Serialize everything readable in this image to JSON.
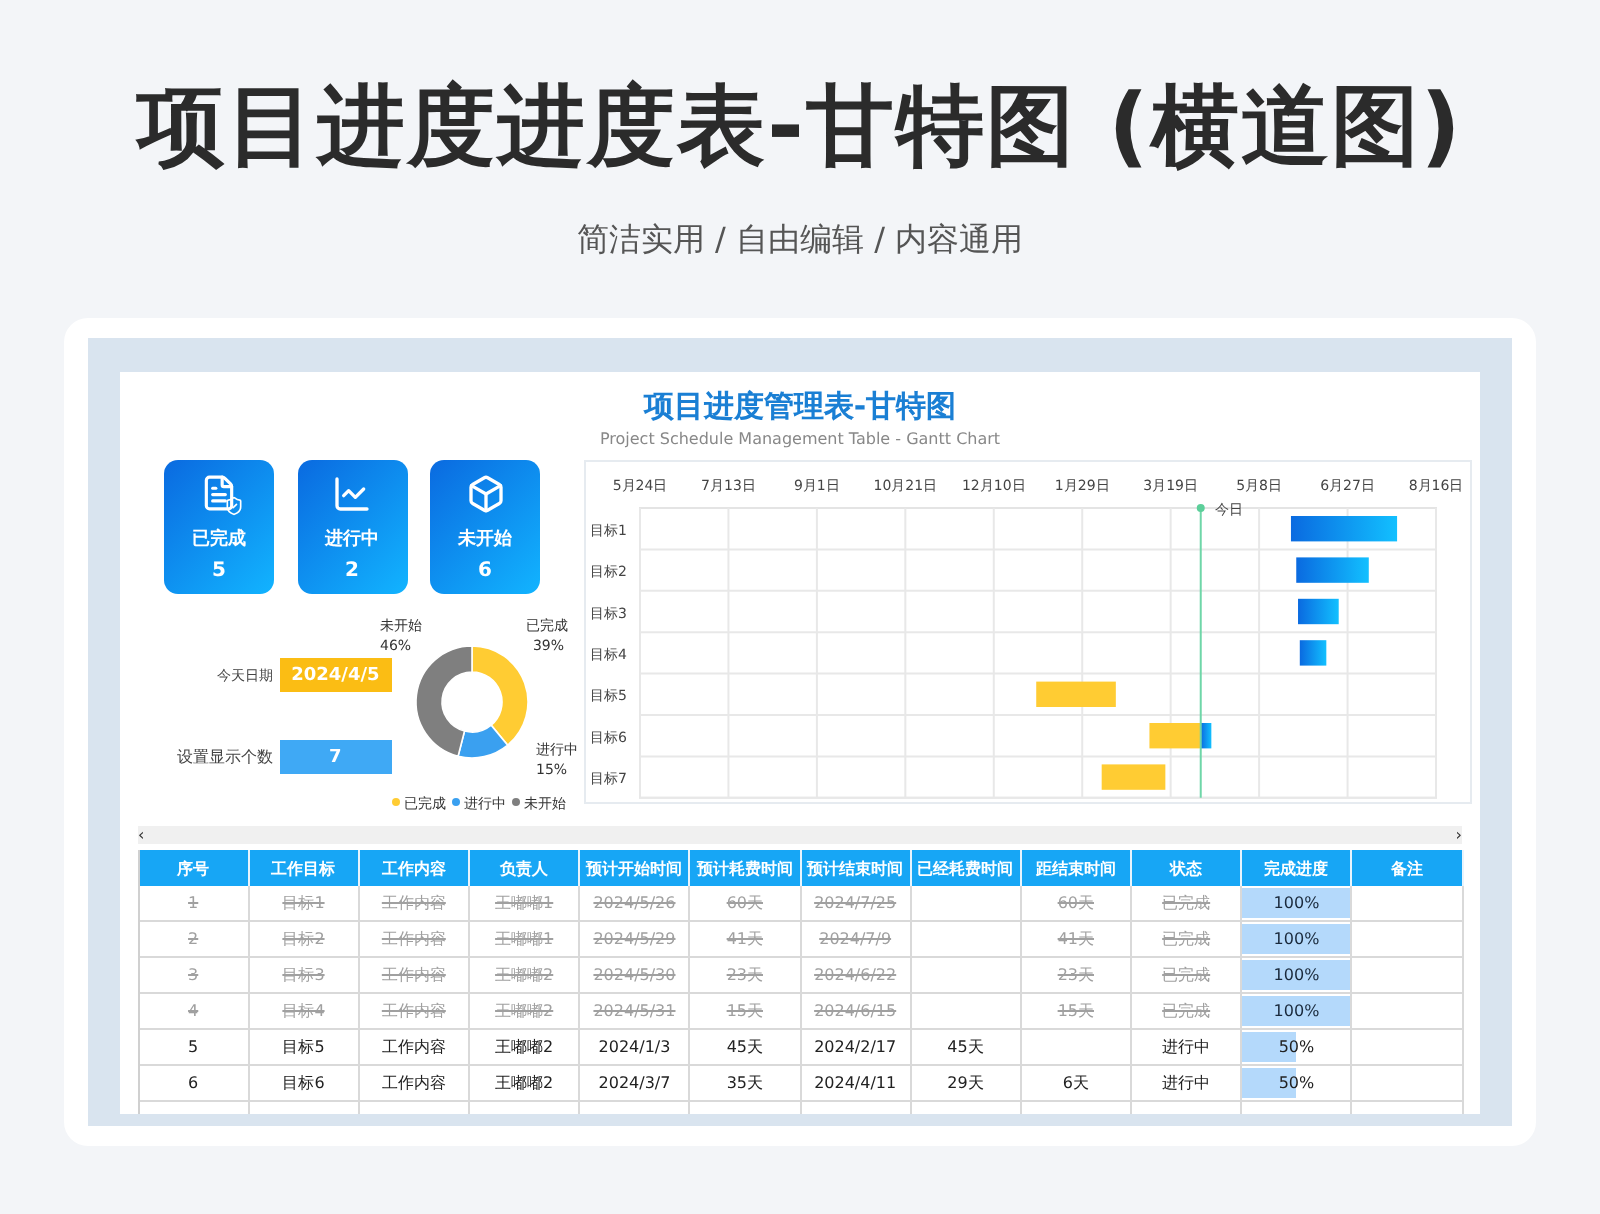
{
  "header": {
    "title": "项目进度进度表-甘特图 (横道图)",
    "subtitle": "简洁实用 / 自由编辑 / 内容通用"
  },
  "sheet": {
    "title": "项目进度管理表-甘特图",
    "subtitle": "Project Schedule Management Table - Gantt Chart"
  },
  "stats": [
    {
      "kind": "document",
      "label": "已完成",
      "count": "5"
    },
    {
      "kind": "chart",
      "label": "进行中",
      "count": "2"
    },
    {
      "kind": "box",
      "label": "未开始",
      "count": "6"
    }
  ],
  "today": {
    "label": "今天日期",
    "value": "2024/4/5"
  },
  "display_count": {
    "label": "设置显示个数",
    "value": "7"
  },
  "status_chart": {
    "chart_data": {
      "type": "donut",
      "categories": [
        "已完成",
        "进行中",
        "未开始"
      ],
      "colors": [
        "#ffcc33",
        "#3aa0f0",
        "#7f7f7f"
      ],
      "values": [
        39,
        15,
        46
      ],
      "value_labels": [
        "39%",
        "15%",
        "46%"
      ],
      "legend": true
    }
  },
  "gantt": {
    "axis_labels": [
      "5月24日",
      "7月13日",
      "9月1日",
      "10月21日",
      "12月10日",
      "1月29日",
      "3月19日",
      "5月8日",
      "6月27日",
      "8月16日"
    ],
    "tasks": [
      "目标1",
      "目标2",
      "目标3",
      "目标4",
      "目标5",
      "目标6",
      "目标7"
    ],
    "today_label": "今日"
  },
  "scrollbar": {
    "left": "‹",
    "right": "›"
  },
  "table": {
    "columns": [
      "序号",
      "工作目标",
      "工作内容",
      "负责人",
      "预计开始时间",
      "预计耗费时间",
      "预计结束时间",
      "已经耗费时间",
      "距结束时间",
      "状态",
      "完成进度",
      "备注"
    ],
    "rows": [
      {
        "done": true,
        "index": "1",
        "goal": "目标1",
        "content": "工作内容",
        "owner": "王嘟嘟1",
        "start": "2024/5/26",
        "duration": "60天",
        "end": "2024/7/25",
        "remaining": "60天",
        "status": "已完成",
        "progress": {
          "text": "100%",
          "level": 1
        }
      },
      {
        "done": true,
        "index": "2",
        "goal": "目标2",
        "content": "工作内容",
        "owner": "王嘟嘟1",
        "start": "2024/5/29",
        "duration": "41天",
        "end": "2024/7/9",
        "remaining": "41天",
        "status": "已完成",
        "progress": {
          "text": "100%",
          "level": 1
        }
      },
      {
        "done": true,
        "index": "3",
        "goal": "目标3",
        "content": "工作内容",
        "owner": "王嘟嘟2",
        "start": "2024/5/30",
        "duration": "23天",
        "end": "2024/6/22",
        "remaining": "23天",
        "status": "已完成",
        "progress": {
          "text": "100%",
          "level": 1
        }
      },
      {
        "done": true,
        "index": "4",
        "goal": "目标4",
        "content": "工作内容",
        "owner": "王嘟嘟2",
        "start": "2024/5/31",
        "duration": "15天",
        "end": "2024/6/15",
        "remaining": "15天",
        "status": "已完成",
        "progress": {
          "text": "100%",
          "level": 1
        }
      },
      {
        "done": false,
        "index": "5",
        "goal": "目标5",
        "content": "工作内容",
        "owner": "王嘟嘟2",
        "start": "2024/1/3",
        "duration": "45天",
        "end": "2024/2/17",
        "elapsed": "45天",
        "status": "进行中",
        "progress": {
          "text": "50%",
          "level": 0.5
        }
      },
      {
        "done": false,
        "index": "6",
        "goal": "目标6",
        "content": "工作内容",
        "owner": "王嘟嘟2",
        "start": "2024/3/7",
        "duration": "35天",
        "end": "2024/4/11",
        "elapsed": "29天",
        "remaining": "6天",
        "status": "进行中",
        "progress": {
          "text": "50%",
          "level": 0.5
        }
      }
    ]
  }
}
